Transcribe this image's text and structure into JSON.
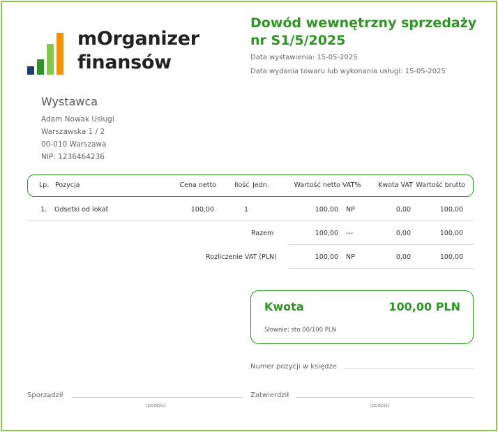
{
  "logo": {
    "line1": "mOrganizer",
    "line2": "finansów",
    "bar_colors": [
      "#1f3b73",
      "#2e9424",
      "#86c94a",
      "#f39200"
    ]
  },
  "document": {
    "title_line1": "Dowód wewnętrzny sprzedaży",
    "title_line2": "nr S1/5/2025",
    "issue_date": "Data wystawienia: 15-05-2025",
    "delivery_date": "Data wydania towaru lub wykonania usługi: 15-05-2025"
  },
  "issuer": {
    "heading": "Wystawca",
    "name": "Adam Nowak Usługi",
    "street": "Warszawska 1 / 2",
    "city": "00-010 Warszawa",
    "nip": "NIP: 1236464236"
  },
  "table": {
    "headers": {
      "lp": "Lp.",
      "item": "Pozycja",
      "net_price": "Cena netto",
      "qty": "Ilość",
      "unit": "Jedn.",
      "net_value": "Wartość netto",
      "vat_rate": "VAT%",
      "vat_amount": "Kwota VAT",
      "gross_value": "Wartość brutto"
    },
    "rows": [
      {
        "lp": "1.",
        "item": "Odsetki od lokat",
        "net_price": "100,00",
        "qty": "1",
        "unit": "",
        "net_value": "100,00",
        "vat_rate": "NP",
        "vat_amount": "0,00",
        "gross_value": "100,00"
      }
    ],
    "total": {
      "label": "Razem",
      "net_value": "100,00",
      "vat_rate": "---",
      "vat_amount": "0,00",
      "gross_value": "100,00"
    },
    "vat_settlement": {
      "label": "Rozliczenie VAT (PLN)",
      "net_value": "100,00",
      "vat_rate": "NP",
      "vat_amount": "0,00",
      "gross_value": "100,00"
    }
  },
  "amount": {
    "label": "Kwota",
    "value": "100,00 PLN",
    "in_words": "Słownie: sto 00/100 PLN"
  },
  "signatures": {
    "ledger_label": "Numer pozycji w księdze",
    "prepared_label": "Sporządził",
    "approved_label": "Zatwierdził",
    "prepared_note": "(podpis)",
    "approved_note": "(podpis)"
  }
}
